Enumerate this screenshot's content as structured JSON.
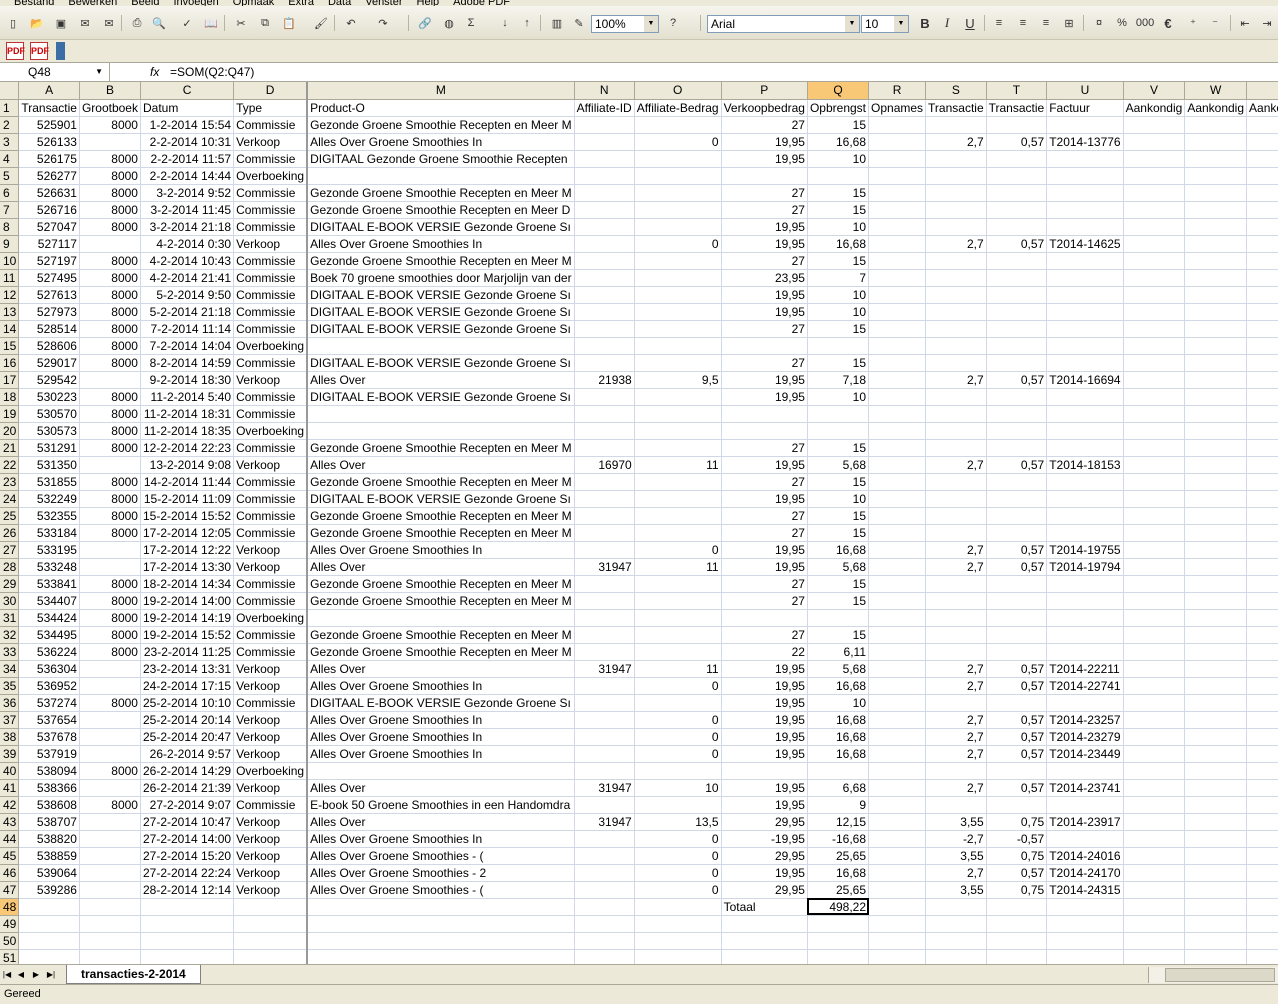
{
  "app": {
    "menu": [
      "Bestand",
      "Bewerken",
      "Beeld",
      "Invoegen",
      "Opmaak",
      "Extra",
      "Data",
      "Venster",
      "Help",
      "Adobe PDF"
    ]
  },
  "toolbar": {
    "zoom": "100%",
    "font_name": "Arial",
    "font_size": "10",
    "bold_label": "B",
    "italic_label": "I",
    "underline_label": "U",
    "sum_label": "Σ",
    "percent_label": "%",
    "thousands_label": "000",
    "euro_label": "€",
    "pdf1_label": "PDF",
    "pdf2_label": "PDF"
  },
  "formula_bar": {
    "name_box": "Q48",
    "fx": "fx",
    "formula": "=SOM(Q2:Q47)"
  },
  "grid": {
    "columns": [
      "A",
      "B",
      "C",
      "D",
      "M",
      "N",
      "O",
      "P",
      "Q",
      "R",
      "S",
      "T",
      "U",
      "V",
      "W",
      "X"
    ],
    "row_numbers": [
      "1",
      "2",
      "3",
      "4",
      "5",
      "6",
      "7",
      "8",
      "9",
      "10",
      "11",
      "12",
      "13",
      "14",
      "15",
      "16",
      "17",
      "18",
      "19",
      "20",
      "21",
      "22",
      "23",
      "24",
      "25",
      "26",
      "27",
      "28",
      "29",
      "30",
      "31",
      "32",
      "33",
      "34",
      "35",
      "36",
      "37",
      "38",
      "39",
      "40",
      "41",
      "42",
      "43",
      "44",
      "45",
      "46",
      "47",
      "48",
      "49",
      "50",
      "51"
    ],
    "header_row": [
      "Transactie",
      "Grootboek",
      "Datum",
      "Type",
      "Product-O",
      "Affiliate-ID",
      "Affiliate-Bedrag",
      "Verkoopbedrag",
      "Opbrengst",
      "Opnames",
      "Transactie",
      "Transactie",
      "Factuur",
      "Aankondig",
      "Aankondig",
      "Aankondiging"
    ],
    "rows": [
      [
        "525901",
        "8000",
        "1-2-2014 15:54",
        "Commissie",
        "Gezonde Groene Smoothie Recepten en Meer M",
        "",
        "",
        "27",
        "15",
        "",
        "",
        "",
        "",
        "",
        "",
        ""
      ],
      [
        "526133",
        "",
        "2-2-2014 10:31",
        "Verkoop",
        "Alles Over Groene Smoothies In",
        "",
        "0",
        "19,95",
        "16,68",
        "",
        "2,7",
        "0,57",
        "T2014-13776",
        "",
        "",
        ""
      ],
      [
        "526175",
        "8000",
        "2-2-2014 11:57",
        "Commissie",
        "DIGITAAL Gezonde Groene Smoothie Recepten",
        "",
        "",
        "19,95",
        "10",
        "",
        "",
        "",
        "",
        "",
        "",
        ""
      ],
      [
        "526277",
        "8000",
        "2-2-2014 14:44",
        "Overboeking",
        "",
        "",
        "",
        "",
        "",
        "",
        "",
        "",
        "",
        "",
        "",
        ""
      ],
      [
        "526631",
        "8000",
        "3-2-2014 9:52",
        "Commissie",
        "Gezonde Groene Smoothie Recepten en Meer M",
        "",
        "",
        "27",
        "15",
        "",
        "",
        "",
        "",
        "",
        "",
        ""
      ],
      [
        "526716",
        "8000",
        "3-2-2014 11:45",
        "Commissie",
        "Gezonde Groene Smoothie Recepten en Meer  D",
        "",
        "",
        "27",
        "15",
        "",
        "",
        "",
        "",
        "",
        "",
        ""
      ],
      [
        "527047",
        "8000",
        "3-2-2014 21:18",
        "Commissie",
        "DIGITAAL E-BOOK VERSIE Gezonde Groene Sı",
        "",
        "",
        "19,95",
        "10",
        "",
        "",
        "",
        "",
        "",
        "",
        ""
      ],
      [
        "527117",
        "",
        "4-2-2014 0:30",
        "Verkoop",
        "Alles Over Groene Smoothies In",
        "",
        "0",
        "19,95",
        "16,68",
        "",
        "2,7",
        "0,57",
        "T2014-14625",
        "",
        "",
        ""
      ],
      [
        "527197",
        "8000",
        "4-2-2014 10:43",
        "Commissie",
        "Gezonde Groene Smoothie Recepten en Meer M",
        "",
        "",
        "27",
        "15",
        "",
        "",
        "",
        "",
        "",
        "",
        ""
      ],
      [
        "527495",
        "8000",
        "4-2-2014 21:41",
        "Commissie",
        "Boek 70 groene smoothies door Marjolijn van der",
        "",
        "",
        "23,95",
        "7",
        "",
        "",
        "",
        "",
        "",
        "",
        ""
      ],
      [
        "527613",
        "8000",
        "5-2-2014 9:50",
        "Commissie",
        "DIGITAAL E-BOOK VERSIE Gezonde Groene Sı",
        "",
        "",
        "19,95",
        "10",
        "",
        "",
        "",
        "",
        "",
        "",
        ""
      ],
      [
        "527973",
        "8000",
        "5-2-2014 21:18",
        "Commissie",
        "DIGITAAL E-BOOK VERSIE Gezonde Groene Sı",
        "",
        "",
        "19,95",
        "10",
        "",
        "",
        "",
        "",
        "",
        "",
        ""
      ],
      [
        "528514",
        "8000",
        "7-2-2014 11:14",
        "Commissie",
        "DIGITAAL E-BOOK VERSIE Gezonde Groene Sı",
        "",
        "",
        "27",
        "15",
        "",
        "",
        "",
        "",
        "",
        "",
        ""
      ],
      [
        "528606",
        "8000",
        "7-2-2014 14:04",
        "Overboeking",
        "",
        "",
        "",
        "",
        "",
        "",
        "",
        "",
        "",
        "",
        "",
        ""
      ],
      [
        "529017",
        "8000",
        "8-2-2014 14:59",
        "Commissie",
        "DIGITAAL E-BOOK VERSIE Gezonde Groene Sı",
        "",
        "",
        "27",
        "15",
        "",
        "",
        "",
        "",
        "",
        "",
        ""
      ],
      [
        "529542",
        "",
        "9-2-2014 18:30",
        "Verkoop",
        "Alles Over",
        "21938",
        "9,5",
        "19,95",
        "7,18",
        "",
        "2,7",
        "0,57",
        "T2014-16694",
        "",
        "",
        ""
      ],
      [
        "530223",
        "8000",
        "11-2-2014 5:40",
        "Commissie",
        "DIGITAAL E-BOOK VERSIE Gezonde Groene Sı",
        "",
        "",
        "19,95",
        "10",
        "",
        "",
        "",
        "",
        "",
        "",
        ""
      ],
      [
        "530570",
        "8000",
        "11-2-2014 18:31",
        "Commissie",
        "",
        "",
        "",
        "",
        "",
        "",
        "",
        "",
        "",
        "",
        "",
        ""
      ],
      [
        "530573",
        "8000",
        "11-2-2014 18:35",
        "Overboeking",
        "",
        "",
        "",
        "",
        "",
        "",
        "",
        "",
        "",
        "",
        "",
        ""
      ],
      [
        "531291",
        "8000",
        "12-2-2014 22:23",
        "Commissie",
        "Gezonde Groene Smoothie Recepten en Meer M",
        "",
        "",
        "27",
        "15",
        "",
        "",
        "",
        "",
        "",
        "",
        ""
      ],
      [
        "531350",
        "",
        "13-2-2014 9:08",
        "Verkoop",
        "Alles Over",
        "16970",
        "11",
        "19,95",
        "5,68",
        "",
        "2,7",
        "0,57",
        "T2014-18153",
        "",
        "",
        ""
      ],
      [
        "531855",
        "8000",
        "14-2-2014 11:44",
        "Commissie",
        "Gezonde Groene Smoothie Recepten en Meer M",
        "",
        "",
        "27",
        "15",
        "",
        "",
        "",
        "",
        "",
        "",
        ""
      ],
      [
        "532249",
        "8000",
        "15-2-2014 11:09",
        "Commissie",
        "DIGITAAL E-BOOK VERSIE Gezonde Groene Sı",
        "",
        "",
        "19,95",
        "10",
        "",
        "",
        "",
        "",
        "",
        "",
        ""
      ],
      [
        "532355",
        "8000",
        "15-2-2014 15:52",
        "Commissie",
        "Gezonde Groene Smoothie Recepten en Meer M",
        "",
        "",
        "27",
        "15",
        "",
        "",
        "",
        "",
        "",
        "",
        ""
      ],
      [
        "533184",
        "8000",
        "17-2-2014 12:05",
        "Commissie",
        "Gezonde Groene Smoothie Recepten en Meer M",
        "",
        "",
        "27",
        "15",
        "",
        "",
        "",
        "",
        "",
        "",
        ""
      ],
      [
        "533195",
        "",
        "17-2-2014 12:22",
        "Verkoop",
        "Alles Over Groene Smoothies In",
        "",
        "0",
        "19,95",
        "16,68",
        "",
        "2,7",
        "0,57",
        "T2014-19755",
        "",
        "",
        ""
      ],
      [
        "533248",
        "",
        "17-2-2014 13:30",
        "Verkoop",
        "Alles Over",
        "31947",
        "11",
        "19,95",
        "5,68",
        "",
        "2,7",
        "0,57",
        "T2014-19794",
        "",
        "",
        ""
      ],
      [
        "533841",
        "8000",
        "18-2-2014 14:34",
        "Commissie",
        "Gezonde Groene Smoothie Recepten en Meer M",
        "",
        "",
        "27",
        "15",
        "",
        "",
        "",
        "",
        "",
        "",
        ""
      ],
      [
        "534407",
        "8000",
        "19-2-2014 14:00",
        "Commissie",
        "Gezonde Groene Smoothie Recepten en Meer M",
        "",
        "",
        "27",
        "15",
        "",
        "",
        "",
        "",
        "",
        "",
        ""
      ],
      [
        "534424",
        "8000",
        "19-2-2014 14:19",
        "Overboeking",
        "",
        "",
        "",
        "",
        "",
        "",
        "",
        "",
        "",
        "",
        "",
        ""
      ],
      [
        "534495",
        "8000",
        "19-2-2014 15:52",
        "Commissie",
        "Gezonde Groene Smoothie Recepten en Meer M",
        "",
        "",
        "27",
        "15",
        "",
        "",
        "",
        "",
        "",
        "",
        ""
      ],
      [
        "536224",
        "8000",
        "23-2-2014 11:25",
        "Commissie",
        "Gezonde Groene Smoothie Recepten en Meer M",
        "",
        "",
        "22",
        "6,11",
        "",
        "",
        "",
        "",
        "",
        "",
        ""
      ],
      [
        "536304",
        "",
        "23-2-2014 13:31",
        "Verkoop",
        "Alles Over",
        "31947",
        "11",
        "19,95",
        "5,68",
        "",
        "2,7",
        "0,57",
        "T2014-22211",
        "",
        "",
        ""
      ],
      [
        "536952",
        "",
        "24-2-2014 17:15",
        "Verkoop",
        "Alles Over Groene Smoothies In",
        "",
        "0",
        "19,95",
        "16,68",
        "",
        "2,7",
        "0,57",
        "T2014-22741",
        "",
        "",
        ""
      ],
      [
        "537274",
        "8000",
        "25-2-2014 10:10",
        "Commissie",
        "DIGITAAL E-BOOK VERSIE Gezonde Groene Sı",
        "",
        "",
        "19,95",
        "10",
        "",
        "",
        "",
        "",
        "",
        "",
        ""
      ],
      [
        "537654",
        "",
        "25-2-2014 20:14",
        "Verkoop",
        "Alles Over Groene Smoothies In",
        "",
        "0",
        "19,95",
        "16,68",
        "",
        "2,7",
        "0,57",
        "T2014-23257",
        "",
        "",
        ""
      ],
      [
        "537678",
        "",
        "25-2-2014 20:47",
        "Verkoop",
        "Alles Over Groene Smoothies In",
        "",
        "0",
        "19,95",
        "16,68",
        "",
        "2,7",
        "0,57",
        "T2014-23279",
        "",
        "",
        ""
      ],
      [
        "537919",
        "",
        "26-2-2014 9:57",
        "Verkoop",
        "Alles Over Groene Smoothies In",
        "",
        "0",
        "19,95",
        "16,68",
        "",
        "2,7",
        "0,57",
        "T2014-23449",
        "",
        "",
        ""
      ],
      [
        "538094",
        "8000",
        "26-2-2014 14:29",
        "Overboeking",
        "",
        "",
        "",
        "",
        "",
        "",
        "",
        "",
        "",
        "",
        "",
        ""
      ],
      [
        "538366",
        "",
        "26-2-2014 21:39",
        "Verkoop",
        "Alles Over",
        "31947",
        "10",
        "19,95",
        "6,68",
        "",
        "2,7",
        "0,57",
        "T2014-23741",
        "",
        "",
        ""
      ],
      [
        "538608",
        "8000",
        "27-2-2014 9:07",
        "Commissie",
        "E-book 50 Groene Smoothies in een Handomdra",
        "",
        "",
        "19,95",
        "9",
        "",
        "",
        "",
        "",
        "",
        "",
        ""
      ],
      [
        "538707",
        "",
        "27-2-2014 10:47",
        "Verkoop",
        "Alles Over",
        "31947",
        "13,5",
        "29,95",
        "12,15",
        "",
        "3,55",
        "0,75",
        "T2014-23917",
        "",
        "",
        ""
      ],
      [
        "538820",
        "",
        "27-2-2014 14:00",
        "Verkoop",
        "Alles Over Groene Smoothies In",
        "",
        "0",
        "-19,95",
        "-16,68",
        "",
        "-2,7",
        "-0,57",
        "",
        "",
        "",
        ""
      ],
      [
        "538859",
        "",
        "27-2-2014 15:20",
        "Verkoop",
        "Alles Over Groene Smoothies - (",
        "",
        "0",
        "29,95",
        "25,65",
        "",
        "3,55",
        "0,75",
        "T2014-24016",
        "",
        "",
        ""
      ],
      [
        "539064",
        "",
        "27-2-2014 22:24",
        "Verkoop",
        "Alles Over Groene Smoothies - 2",
        "",
        "0",
        "19,95",
        "16,68",
        "",
        "2,7",
        "0,57",
        "T2014-24170",
        "",
        "",
        ""
      ],
      [
        "539286",
        "",
        "28-2-2014 12:14",
        "Verkoop",
        "Alles Over Groene Smoothies - (",
        "",
        "0",
        "29,95",
        "25,65",
        "",
        "3,55",
        "0,75",
        "T2014-24315",
        "",
        "",
        ""
      ],
      [
        "",
        "",
        "",
        "",
        "",
        "",
        "",
        "Totaal",
        "498,22",
        "",
        "",
        "",
        "",
        "",
        "",
        ""
      ],
      [
        "",
        "",
        "",
        "",
        "",
        "",
        "",
        "",
        "",
        "",
        "",
        "",
        "",
        "",
        "",
        ""
      ],
      [
        "",
        "",
        "",
        "",
        "",
        "",
        "",
        "",
        "",
        "",
        "",
        "",
        "",
        "",
        "",
        ""
      ],
      [
        "",
        "",
        "",
        "",
        "",
        "",
        "",
        "",
        "",
        "",
        "",
        "",
        "",
        "",
        "",
        ""
      ]
    ]
  },
  "sheet_tab": "transacties-2-2014",
  "status": "Gereed"
}
